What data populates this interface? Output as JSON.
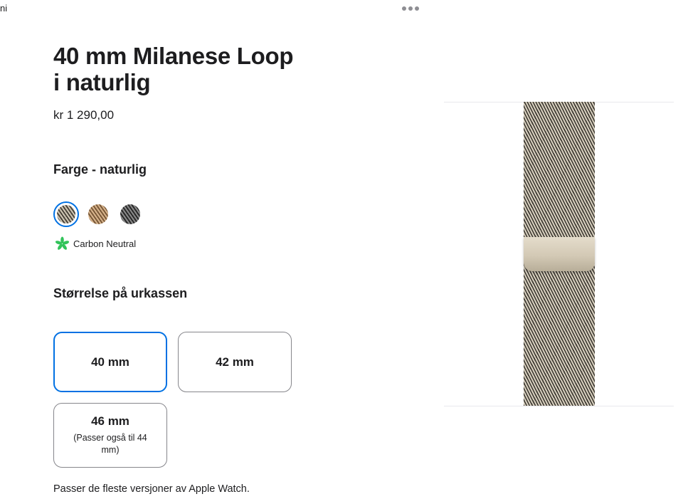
{
  "edge_glyph": "ni",
  "product": {
    "title_line1": "40 mm Milanese Loop",
    "title_line2": "i naturlig",
    "price": "kr 1 290,00"
  },
  "color_section": {
    "heading": "Farge - naturlig",
    "swatches": [
      {
        "name": "naturlig",
        "selected": true,
        "colors": [
          "#4c463d",
          "#cfc6b4"
        ]
      },
      {
        "name": "gold",
        "selected": false,
        "colors": [
          "#7a5a3a",
          "#d8b48c"
        ]
      },
      {
        "name": "slate",
        "selected": false,
        "colors": [
          "#2a2a2a",
          "#8a8a8a"
        ]
      }
    ],
    "carbon_label": "Carbon Neutral"
  },
  "size_section": {
    "heading": "Størrelse på urkassen",
    "options": [
      {
        "label": "40 mm",
        "note": "",
        "selected": true
      },
      {
        "label": "42 mm",
        "note": "",
        "selected": false
      },
      {
        "label": "46 mm",
        "note": "(Passer også til 44 mm)",
        "selected": false
      }
    ]
  },
  "fits_text": "Passer de fleste versjoner av Apple Watch.",
  "colors": {
    "accent": "#0071e3",
    "text": "#1d1d1f",
    "leaf": "#32c35a",
    "border": "#86868b"
  },
  "icons": {
    "more": "more-dots-icon",
    "carbon": "leaf-icon"
  }
}
